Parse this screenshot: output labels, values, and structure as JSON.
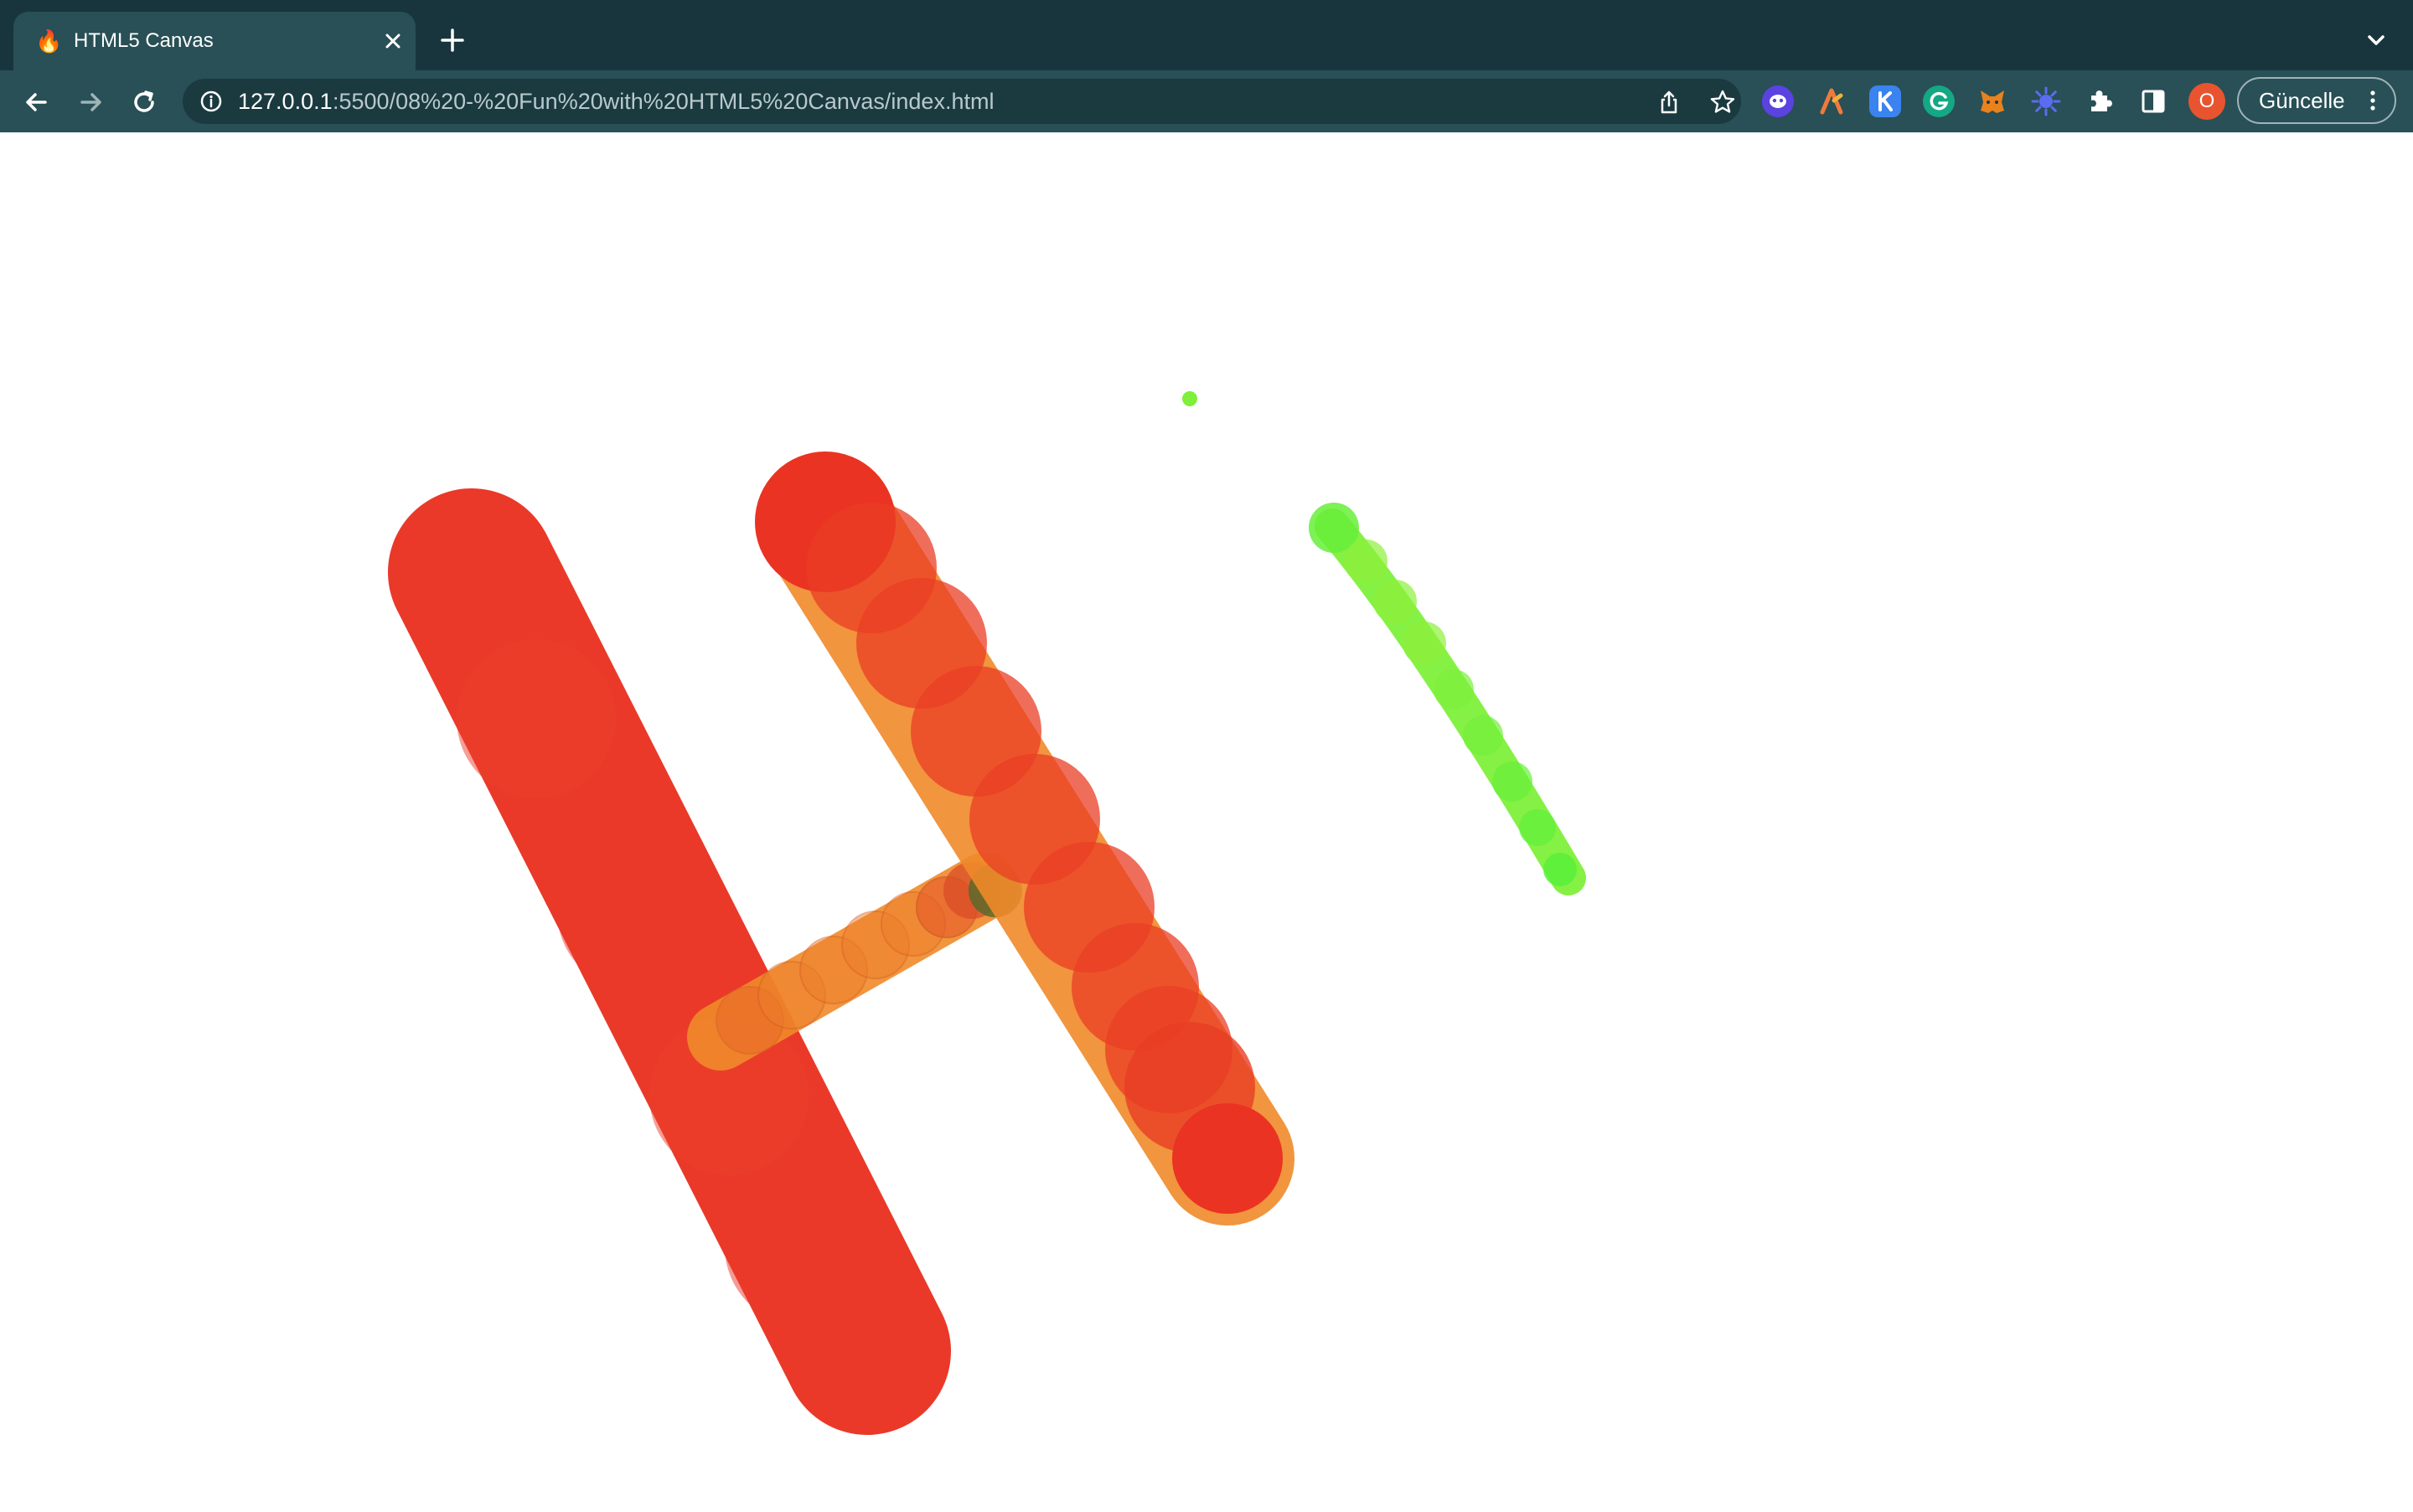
{
  "browser": {
    "tab": {
      "title": "HTML5 Canvas",
      "favicon": "flame-icon"
    },
    "address": {
      "host": "127.0.0.1",
      "path": ":5500/08%20-%20Fun%20with%20HTML5%20Canvas/index.html"
    },
    "profile_initial": "O",
    "update_label": "Güncelle"
  },
  "drawing": {
    "description_colors": {
      "red": "#ea3323",
      "orange": "#f08a2a",
      "green": "#66f233"
    }
  }
}
